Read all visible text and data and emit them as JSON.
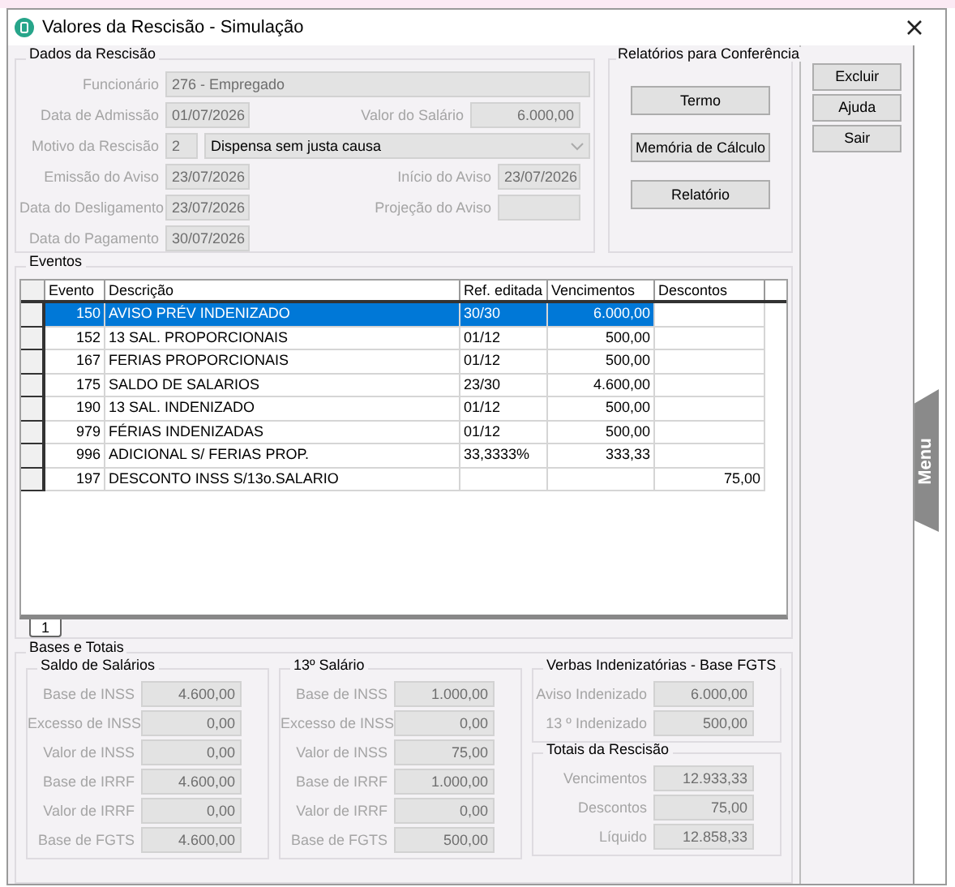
{
  "window": {
    "title": "Valores da Rescisão - Simulação"
  },
  "dados": {
    "title": "Dados da Rescisão",
    "funcionario": {
      "label": "Funcionário",
      "value": "276 - Empregado"
    },
    "admissao": {
      "label": "Data de Admissão",
      "value": "01/07/2026"
    },
    "salario": {
      "label": "Valor do Salário",
      "value": "6.000,00"
    },
    "motivo": {
      "label": "Motivo da Rescisão",
      "code": "2",
      "value": "Dispensa sem justa causa"
    },
    "emissao": {
      "label": "Emissão do Aviso",
      "value": "23/07/2026"
    },
    "inicio": {
      "label": "Início do Aviso",
      "value": "23/07/2026"
    },
    "desligamento": {
      "label": "Data do Desligamento",
      "value": "23/07/2026"
    },
    "projecao": {
      "label": "Projeção do Aviso"
    },
    "pagamento": {
      "label": "Data do Pagamento",
      "value": "30/07/2026"
    }
  },
  "relatorios": {
    "title": "Relatórios para Conferência",
    "buttons": [
      "Termo",
      "Memória de Cálculo",
      "Relatório"
    ]
  },
  "side_buttons": [
    "Excluir",
    "Ajuda",
    "Sair"
  ],
  "eventos": {
    "title": "Eventos",
    "columns": [
      "Evento",
      "Descrição",
      "Ref. editada",
      "Vencimentos",
      "Descontos"
    ],
    "rows": [
      {
        "evento": "150",
        "descricao": "AVISO PRÉV INDENIZADO",
        "ref": "30/30",
        "vencimentos": "6.000,00",
        "selected": true
      },
      {
        "evento": "152",
        "descricao": "13 SAL. PROPORCIONAIS",
        "ref": "01/12",
        "vencimentos": "500,00",
        "selected": false
      },
      {
        "evento": "167",
        "descricao": "FERIAS PROPORCIONAIS",
        "ref": "01/12",
        "vencimentos": "500,00",
        "selected": false
      },
      {
        "evento": "175",
        "descricao": "SALDO DE SALARIOS",
        "ref": "23/30",
        "vencimentos": "4.600,00",
        "selected": false
      },
      {
        "evento": "190",
        "descricao": "13 SAL. INDENIZADO",
        "ref": "01/12",
        "vencimentos": "500,00",
        "selected": false
      },
      {
        "evento": "979",
        "descricao": "FÉRIAS INDENIZADAS",
        "ref": "01/12",
        "vencimentos": "500,00",
        "selected": false
      },
      {
        "evento": "996",
        "descricao": "ADICIONAL S/ FERIAS PROP.",
        "ref": "33,3333%",
        "vencimentos": "333,33",
        "selected": false
      },
      {
        "evento": "197",
        "descricao": "DESCONTO INSS S/13o.SALARIO",
        "descontos": "75,00",
        "selected": false
      }
    ],
    "pages": [
      {
        "label": "1",
        "selected": true
      }
    ]
  },
  "bases": {
    "title": "Bases e Totais",
    "columns": [
      [
        {
          "title": "Saldo de Salários",
          "fields": [
            {
              "label": "Base de INSS",
              "value": "4.600,00"
            },
            {
              "label": "Excesso de INSS",
              "value": "0,00"
            },
            {
              "label": "Valor de INSS",
              "value": "0,00"
            },
            {
              "label": "Base de IRRF",
              "value": "4.600,00"
            },
            {
              "label": "Valor de IRRF",
              "value": "0,00"
            },
            {
              "label": "Base de FGTS",
              "value": "4.600,00"
            }
          ]
        }
      ],
      [
        {
          "title": "13º Salário",
          "fields": [
            {
              "label": "Base de INSS",
              "value": "1.000,00"
            },
            {
              "label": "Excesso de INSS",
              "value": "0,00"
            },
            {
              "label": "Valor de INSS",
              "value": "75,00"
            },
            {
              "label": "Base de IRRF",
              "value": "1.000,00"
            },
            {
              "label": "Valor de IRRF",
              "value": "0,00"
            },
            {
              "label": "Base de FGTS",
              "value": "500,00"
            }
          ]
        }
      ],
      [
        {
          "title": "Verbas Indenizatórias - Base FGTS",
          "fields": [
            {
              "label": "Aviso Indenizado",
              "value": "6.000,00"
            },
            {
              "label": "13 º Indenizado",
              "value": "500,00"
            }
          ]
        },
        {
          "title": "Totais da Rescisão",
          "fields": [
            {
              "label": "Vencimentos",
              "value": "12.933,33"
            },
            {
              "label": "Descontos",
              "value": "75,00"
            },
            {
              "label": "Líquido",
              "value": "12.858,33"
            }
          ]
        }
      ]
    ]
  },
  "menu_tab": "Menu"
}
